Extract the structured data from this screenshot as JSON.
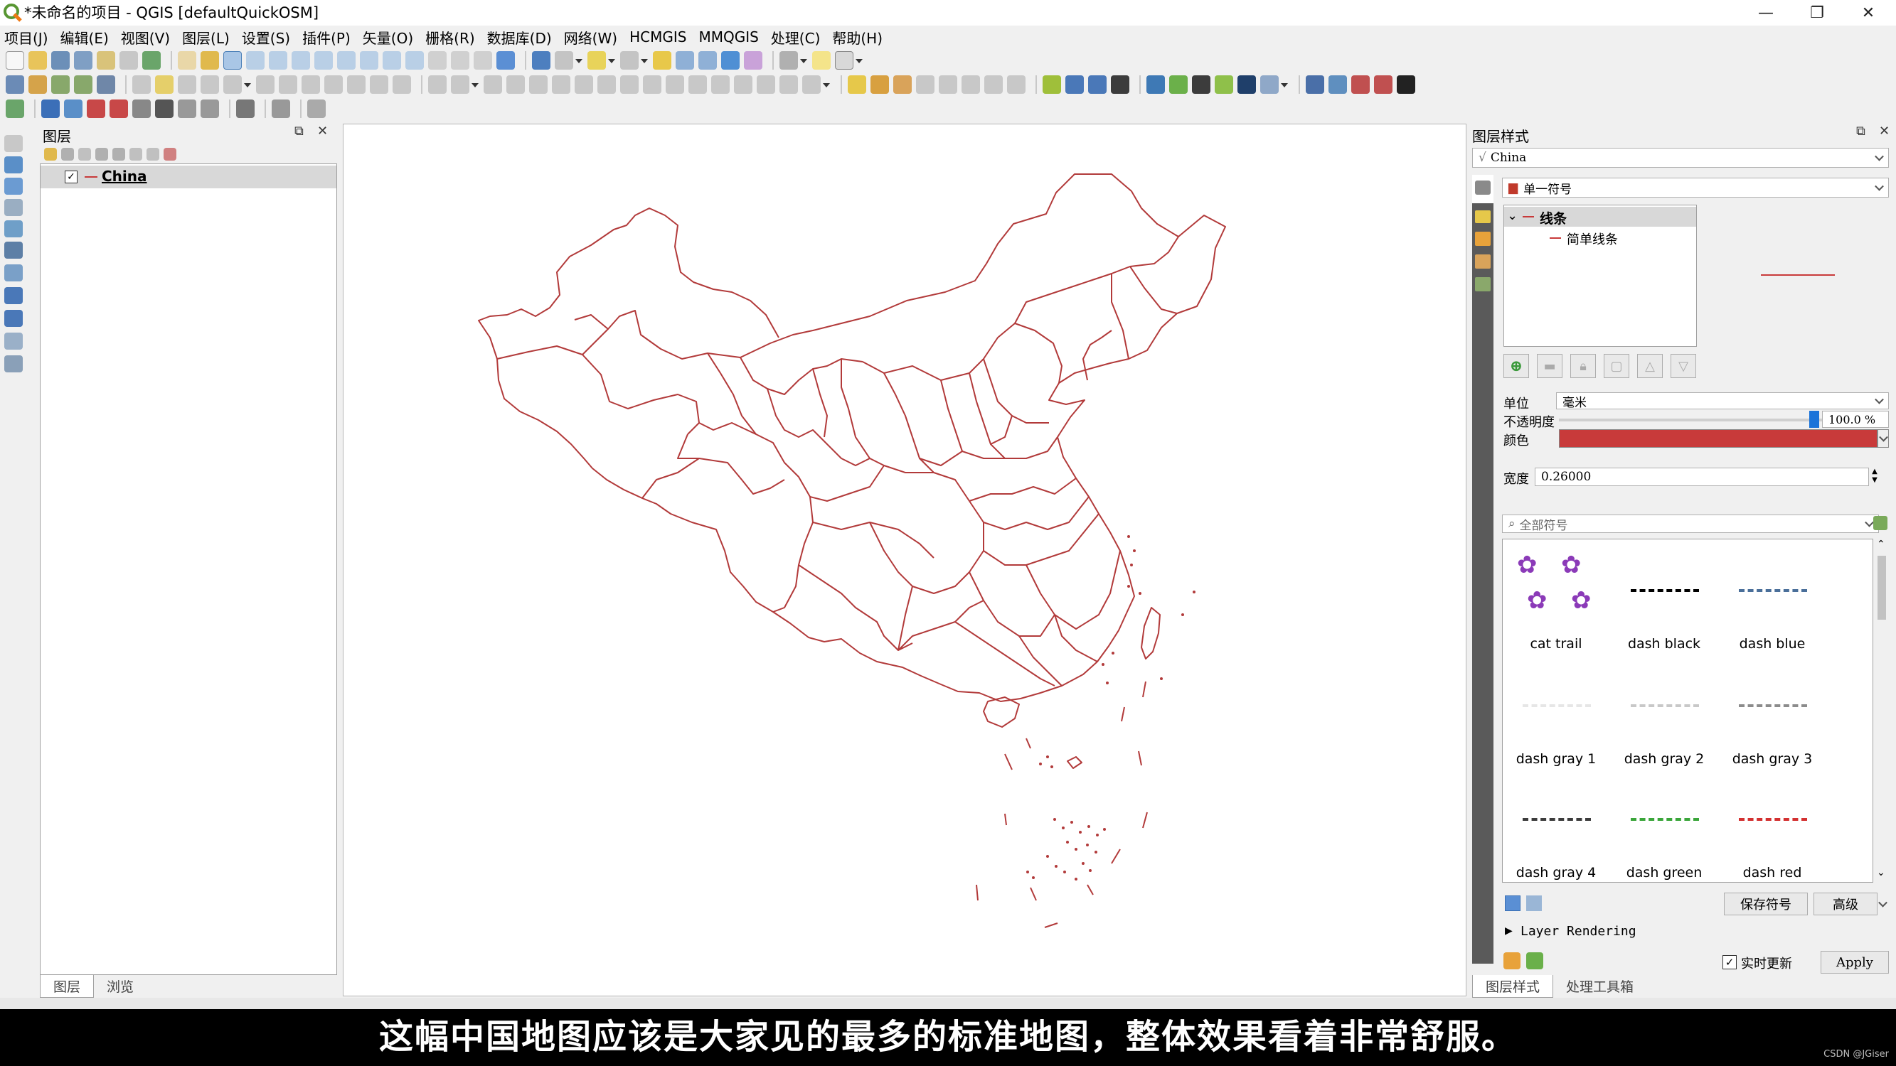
{
  "window": {
    "title": "*未命名的项目 - QGIS [defaultQuickOSM]"
  },
  "menu": [
    "项目(J)",
    "编辑(E)",
    "视图(V)",
    "图层(L)",
    "设置(S)",
    "插件(P)",
    "矢量(O)",
    "栅格(R)",
    "数据库(D)",
    "网络(W)",
    "HCMGIS",
    "MMQGIS",
    "处理(C)",
    "帮助(H)"
  ],
  "layers_panel": {
    "title": "图层",
    "layers": [
      {
        "name": "China",
        "checked": true
      }
    ],
    "tabs": [
      "图层",
      "浏览"
    ]
  },
  "style_panel": {
    "title": "图层样式",
    "layer": "China",
    "renderer": "单一符号",
    "tree_root": "线条",
    "tree_child": "简单线条",
    "unit_label": "单位",
    "unit_value": "毫米",
    "opacity_label": "不透明度",
    "opacity_value": "100.0 %",
    "color_label": "颜色",
    "color": "#c83a3a",
    "width_label": "宽度",
    "width_value": "0.26000",
    "search_placeholder": "全部符号",
    "symbols": [
      {
        "name": "cat trail",
        "style": "paw"
      },
      {
        "name": "dash  black",
        "color": "#000000"
      },
      {
        "name": "dash blue",
        "color": "#4a6f9a"
      },
      {
        "name": "dash gray 1",
        "color": "#e6e6e6"
      },
      {
        "name": "dash gray 2",
        "color": "#c8c8c8"
      },
      {
        "name": "dash gray 3",
        "color": "#8c8c8c"
      },
      {
        "name": "dash gray 4",
        "color": "#3c3c3c"
      },
      {
        "name": "dash green",
        "color": "#3aa63a"
      },
      {
        "name": "dash red",
        "color": "#d33030"
      }
    ],
    "save_symbol": "保存符号",
    "advanced": "高级",
    "layer_rendering": "Layer Rendering",
    "live_update": "实时更新",
    "apply": "Apply",
    "tabs": [
      "图层样式",
      "处理工具箱"
    ]
  },
  "map": {
    "line_color": "#b23a3a"
  },
  "subtitle": "这幅中国地图应该是大家见的最多的标准地图，整体效果看着非常舒服。",
  "watermark": "CSDN @JGiser"
}
